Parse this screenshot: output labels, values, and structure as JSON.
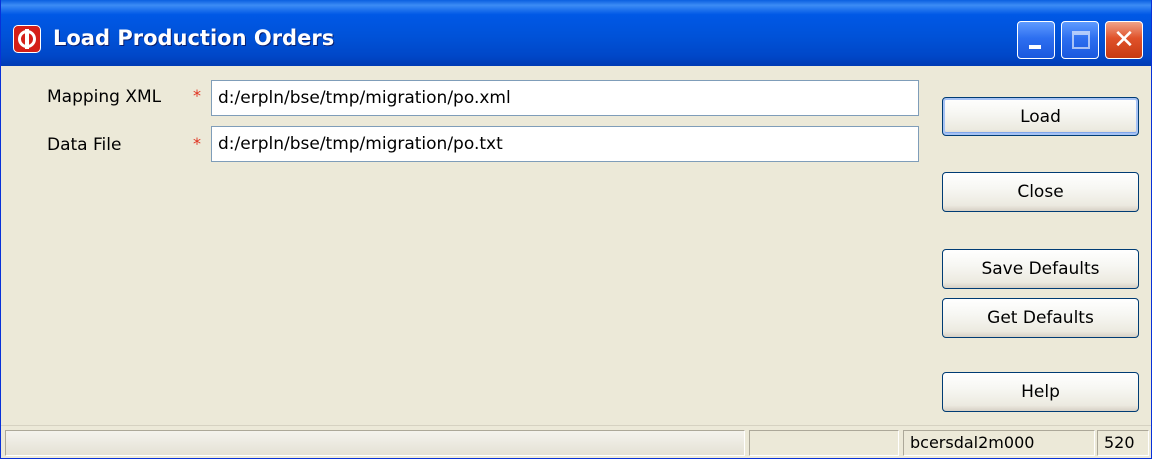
{
  "window": {
    "title": "Load Production Orders",
    "icon": "oracle-app-icon",
    "controls": [
      "minimize",
      "maximize",
      "close"
    ]
  },
  "form": {
    "mapping_xml": {
      "label": "Mapping XML",
      "required_marker": "*",
      "value": "d:/erpln/bse/tmp/migration/po.xml"
    },
    "data_file": {
      "label": "Data File",
      "required_marker": "*",
      "value": "d:/erpln/bse/tmp/migration/po.txt"
    }
  },
  "buttons": {
    "load": "Load",
    "close": "Close",
    "save_defaults": "Save Defaults",
    "get_defaults": "Get Defaults",
    "help": "Help"
  },
  "statusbar": {
    "pane1": "",
    "pane2": "",
    "session": "bcersdal2m000",
    "number": "520"
  },
  "colors": {
    "titlebar": "#0058e6",
    "dialog_bg": "#ece9d8",
    "required": "#e0301e",
    "close_button": "#e0522a"
  }
}
